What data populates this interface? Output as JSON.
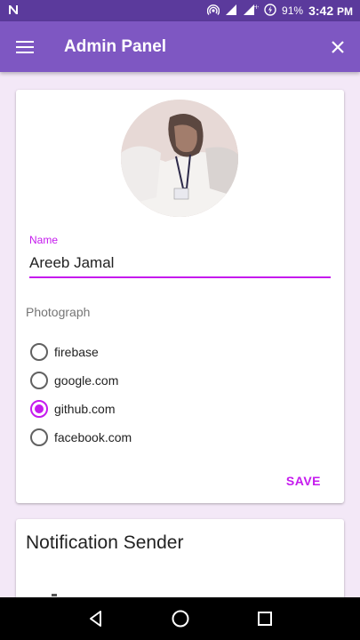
{
  "status_bar": {
    "notification_icon": "n-icon",
    "battery_percent": "91%",
    "time": "3:42",
    "time_suffix": "PM"
  },
  "app_bar": {
    "title": "Admin Panel",
    "menu_icon": "menu-icon",
    "close_icon": "close-icon"
  },
  "profile": {
    "name_label": "Name",
    "name_value": "Areeb Jamal",
    "photograph_label": "Photograph",
    "options": [
      {
        "label": "firebase",
        "checked": false
      },
      {
        "label": "google.com",
        "checked": false
      },
      {
        "label": "github.com",
        "checked": true
      },
      {
        "label": "facebook.com",
        "checked": false
      }
    ],
    "save_label": "SAVE"
  },
  "notification": {
    "title": "Notification Sender"
  },
  "colors": {
    "status_bar": "#5b3a9c",
    "app_bar": "#7e57c2",
    "accent": "#c51aee",
    "background": "#f3e8f7"
  }
}
